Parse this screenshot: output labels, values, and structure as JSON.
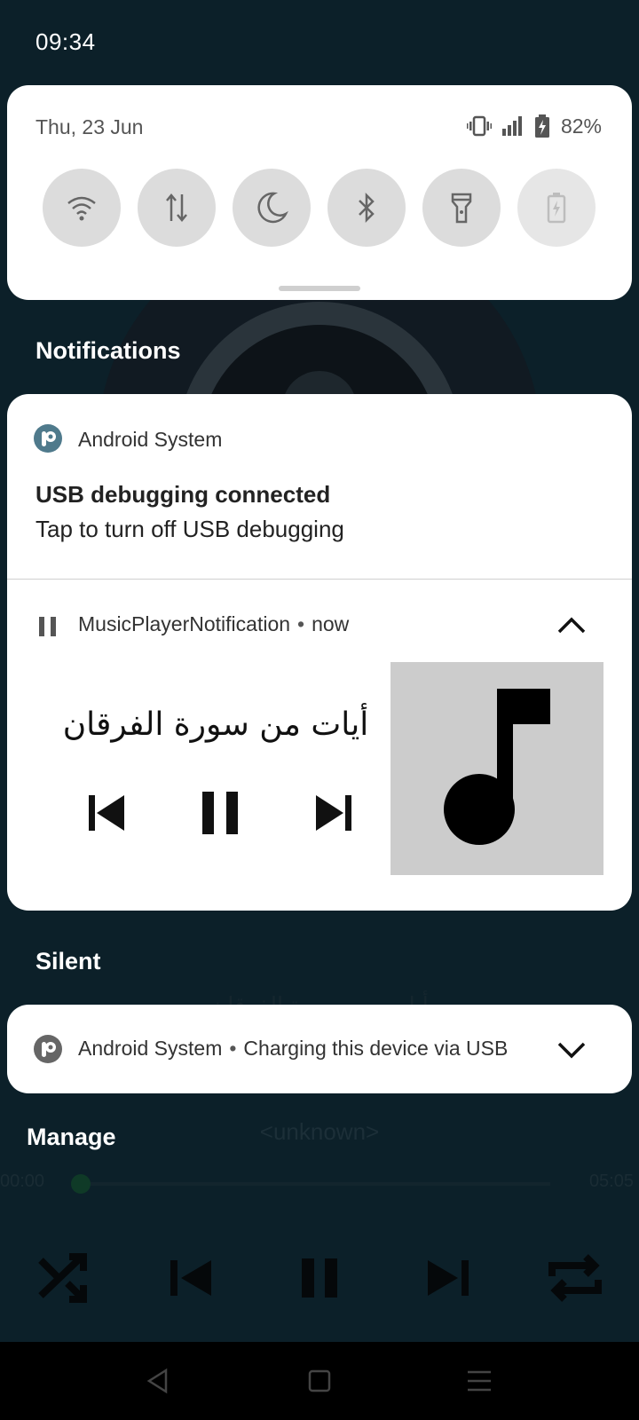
{
  "status_bar": {
    "time": "09:34"
  },
  "quick_settings": {
    "date": "Thu, 23 Jun",
    "battery_percent": "82%",
    "tiles": [
      {
        "name": "wifi-icon",
        "active": false
      },
      {
        "name": "mobile-data-icon",
        "active": false
      },
      {
        "name": "moon-icon",
        "active": false
      },
      {
        "name": "bluetooth-icon",
        "active": false
      },
      {
        "name": "flashlight-icon",
        "active": false
      },
      {
        "name": "battery-saver-icon",
        "active": false,
        "disabled": true
      }
    ]
  },
  "sections": {
    "notifications": "Notifications",
    "silent": "Silent",
    "manage": "Manage"
  },
  "usb_debug_notification": {
    "app_name": "Android System",
    "title": "USB debugging connected",
    "text": "Tap to turn off USB debugging"
  },
  "music_notification": {
    "app_name": "MusicPlayerNotification",
    "separator": "•",
    "time": "now",
    "title": "أيات من سورة الفرقان",
    "state": "playing"
  },
  "silent_notification": {
    "app_name": "Android System",
    "separator": "•",
    "text": "Charging this device via USB"
  },
  "background_app": {
    "title": "أيات من سورة الفرقان",
    "artist": "<unknown>",
    "time_elapsed": "00:00",
    "time_total": "05:05"
  },
  "colors": {
    "scrim": "#0b1e26",
    "card": "#ffffff",
    "tile": "#dcdcdc",
    "album_art_bg": "#cccccc",
    "app_icon": "#4f7a8c"
  }
}
